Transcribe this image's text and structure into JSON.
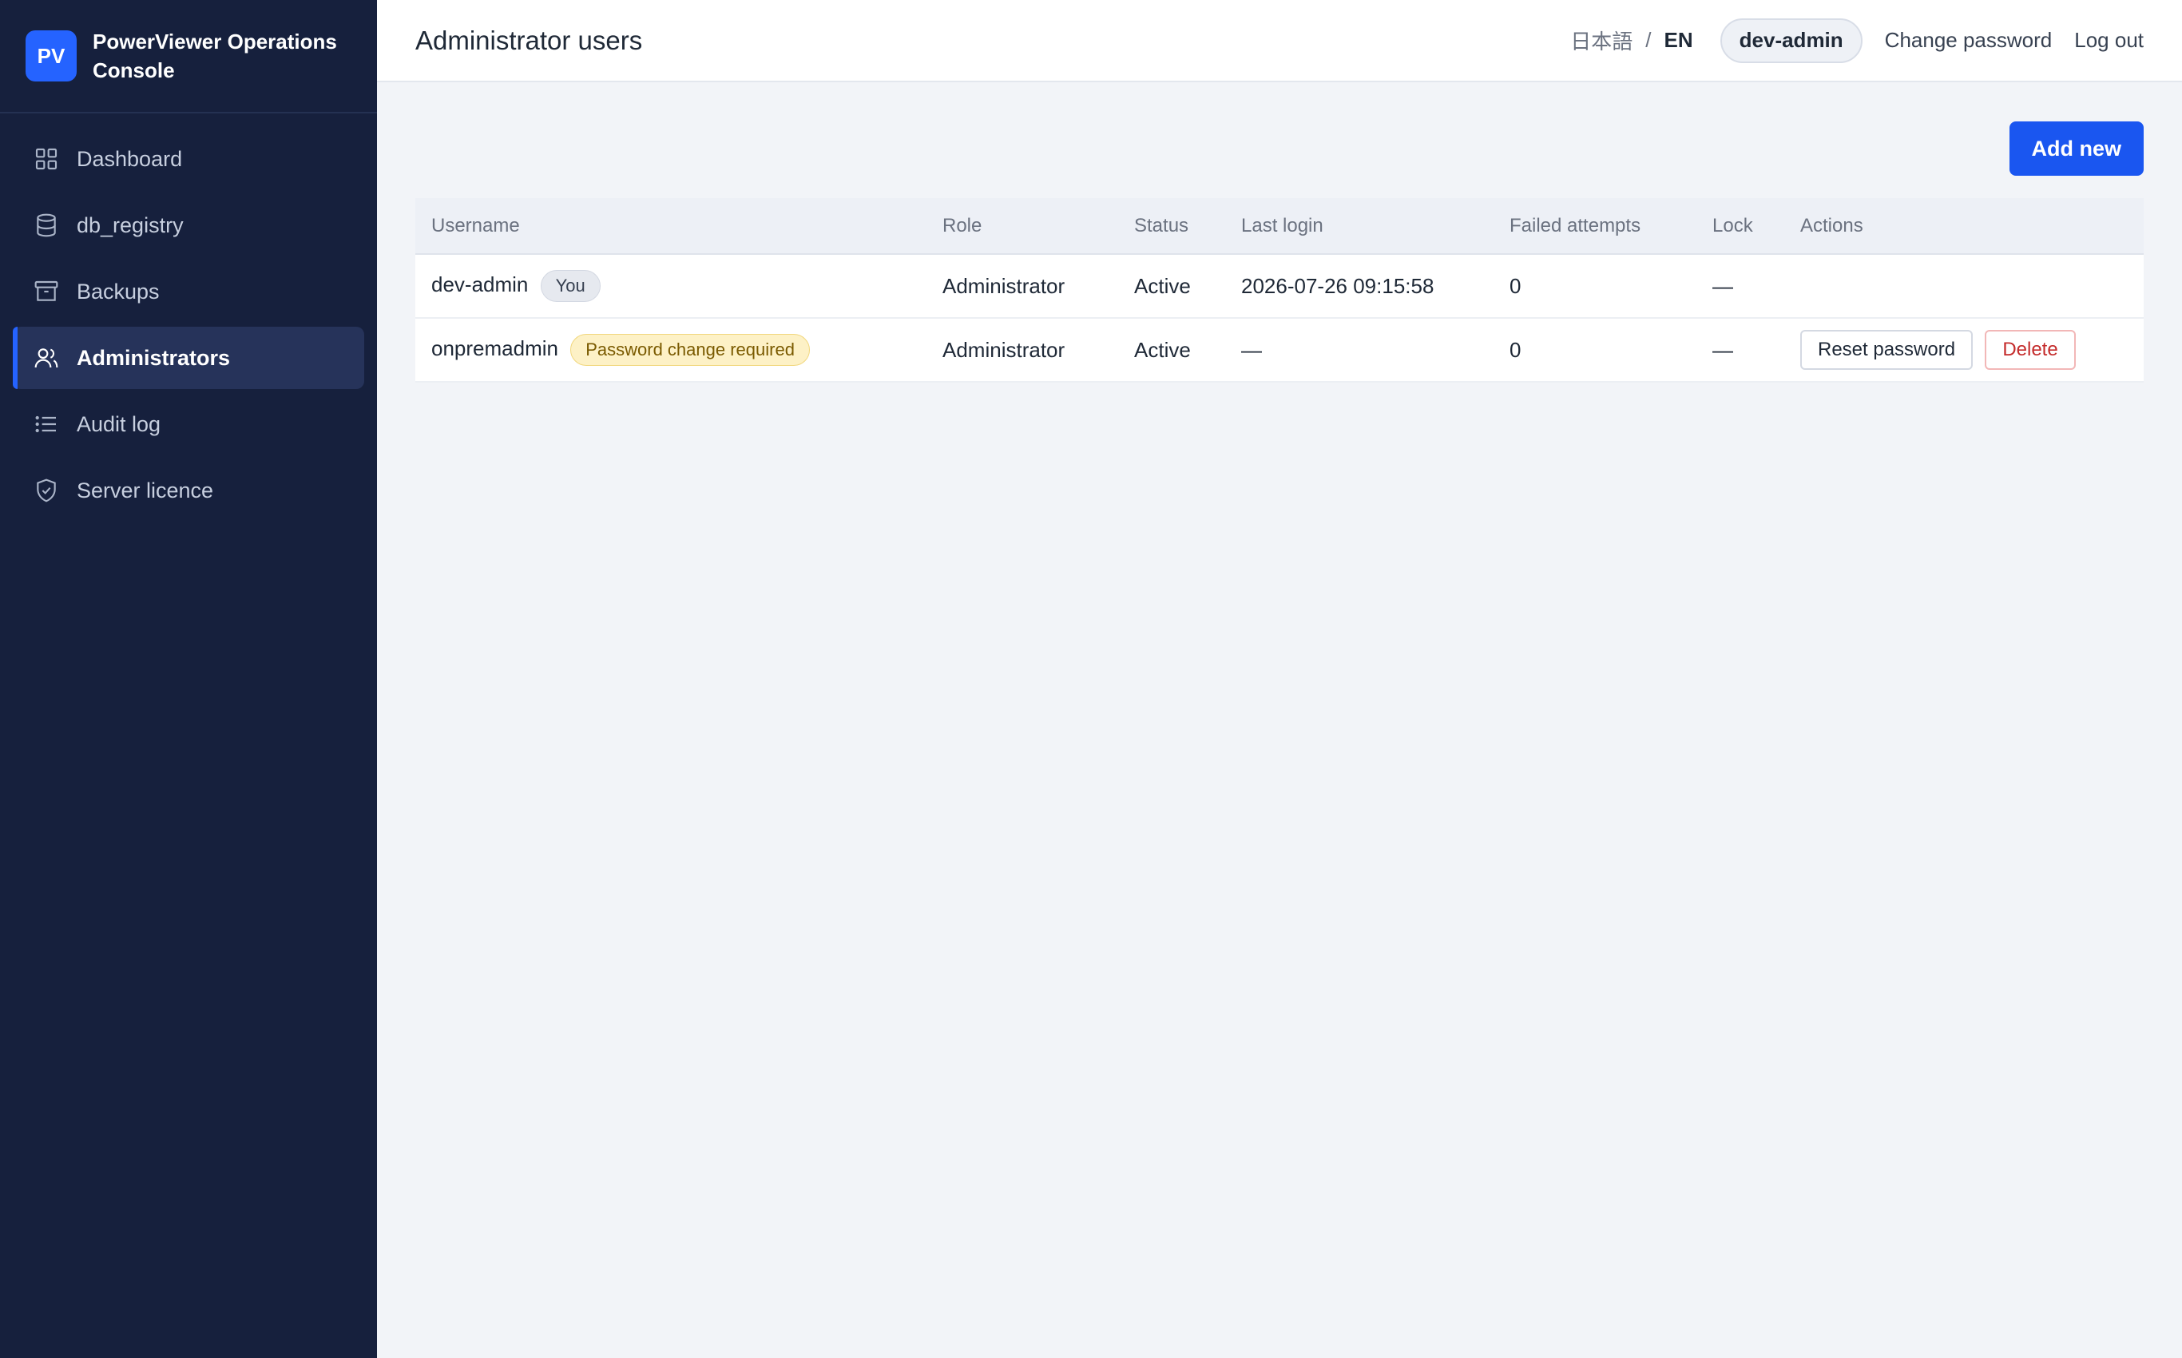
{
  "brand": {
    "logo": "PV",
    "name": "PowerViewer Operations Console"
  },
  "sidebar": {
    "items": [
      {
        "label": "Dashboard",
        "icon": "grid-icon"
      },
      {
        "label": "db_registry",
        "icon": "database-icon"
      },
      {
        "label": "Backups",
        "icon": "archive-icon"
      },
      {
        "label": "Administrators",
        "icon": "users-icon",
        "active": true
      },
      {
        "label": "Audit log",
        "icon": "list-icon"
      },
      {
        "label": "Server licence",
        "icon": "shield-check-icon"
      }
    ]
  },
  "header": {
    "title": "Administrator users",
    "lang_ja": "日本語",
    "lang_sep": "/",
    "lang_en": "EN",
    "current_user": "dev-admin",
    "change_password": "Change password",
    "logout": "Log out"
  },
  "toolbar": {
    "add_new": "Add new"
  },
  "table": {
    "columns": [
      "Username",
      "Role",
      "Status",
      "Last login",
      "Failed attempts",
      "Lock",
      "Actions"
    ],
    "rows": [
      {
        "username": "dev-admin",
        "badge": "You",
        "role": "Administrator",
        "status": "Active",
        "last_login": "2026-07-26 09:15:58",
        "failed_attempts": "0",
        "lock": "—"
      },
      {
        "username": "onpremadmin",
        "badge": "Password change required",
        "role": "Administrator",
        "status": "Active",
        "last_login": "—",
        "failed_attempts": "0",
        "lock": "—",
        "actions": {
          "reset": "Reset password",
          "delete": "Delete"
        }
      }
    ]
  },
  "colors": {
    "sidebar_bg": "#16203d",
    "accent": "#2563ff",
    "primary_button": "#1a56f0",
    "danger": "#c42b2b",
    "warning_badge_bg": "#fdf1c6"
  }
}
